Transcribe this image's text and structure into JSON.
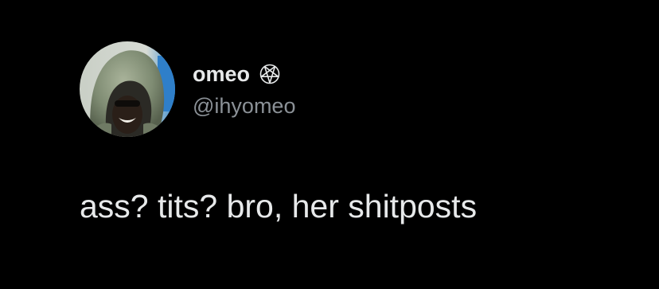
{
  "tweet": {
    "author": {
      "display_name": "omeo",
      "name_glyph_icon": "pentagram-icon",
      "handle": "@ihyomeo",
      "avatar_icon": "avatar-hooded-person"
    },
    "text": "ass? tits? bro, her shitposts"
  },
  "colors": {
    "background": "#000000",
    "primary_text": "#e7e9ea",
    "secondary_text": "#8b9197"
  }
}
